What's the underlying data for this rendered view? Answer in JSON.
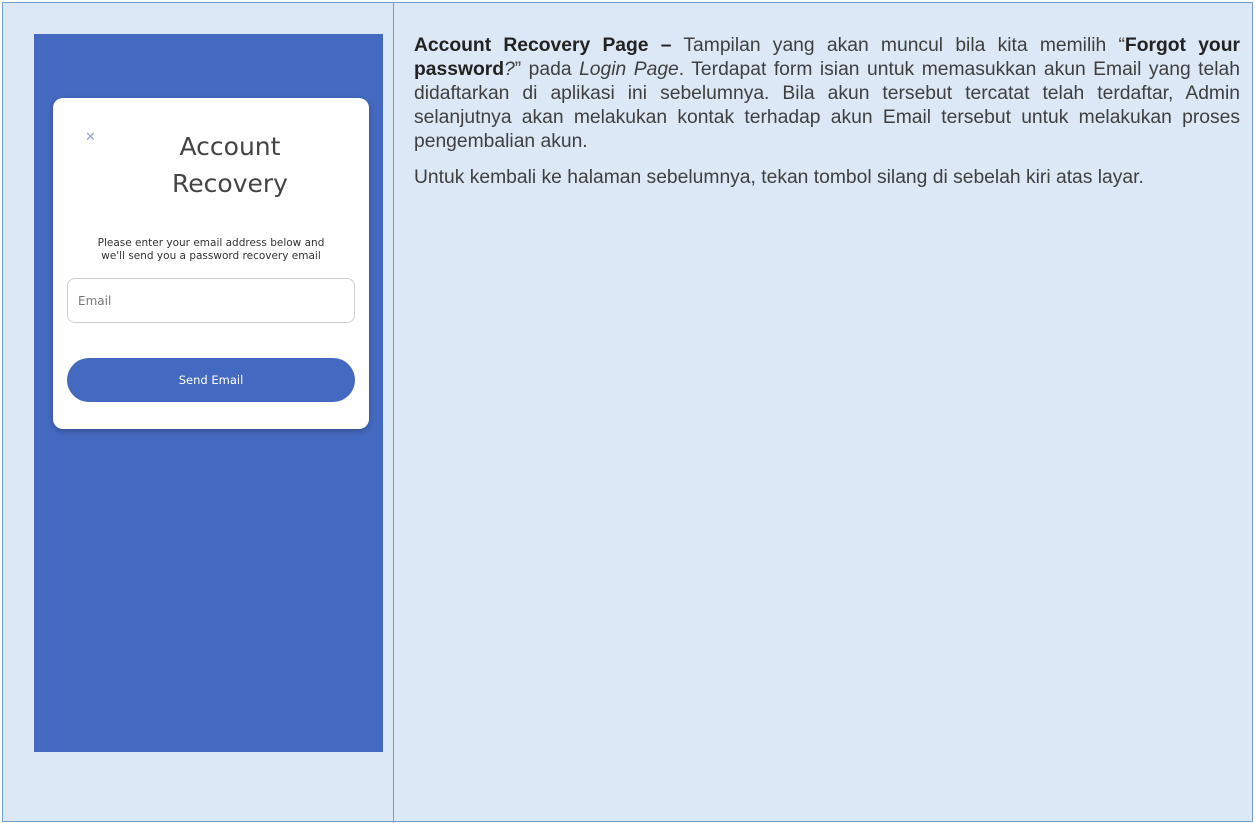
{
  "mockup": {
    "close_icon": "close-icon",
    "title_line1": "Account",
    "title_line2": "Recovery",
    "description_line1": "Please enter your email address below and",
    "description_line2": "we'll send you a password recovery email",
    "email_placeholder": "Email",
    "send_button_label": "Send Email",
    "colors": {
      "screen_background": "#4469c0",
      "button": "#4469c0",
      "card": "#ffffff",
      "cell_background": "#dce8f5",
      "border": "#6fa0d0"
    }
  },
  "description": {
    "p1_heading": "Account Recovery Page –",
    "p1_part1": " Tampilan yang akan muncul bila kita memilih “",
    "p1_forgot": "Forgot your password",
    "p1_question": "?",
    "p1_part2": "” pada ",
    "p1_login": "Login Page",
    "p1_part3": ". Terdapat form isian untuk memasukkan akun Email yang telah didaftarkan di aplikasi ini sebelumnya. Bila akun tersebut tercatat telah terdaftar, Admin selanjutnya akan melakukan kontak terhadap akun Email tersebut untuk melakukan proses pengembalian akun.",
    "p2": "Untuk kembali ke halaman sebelumnya, tekan tombol silang di sebelah kiri atas layar."
  }
}
